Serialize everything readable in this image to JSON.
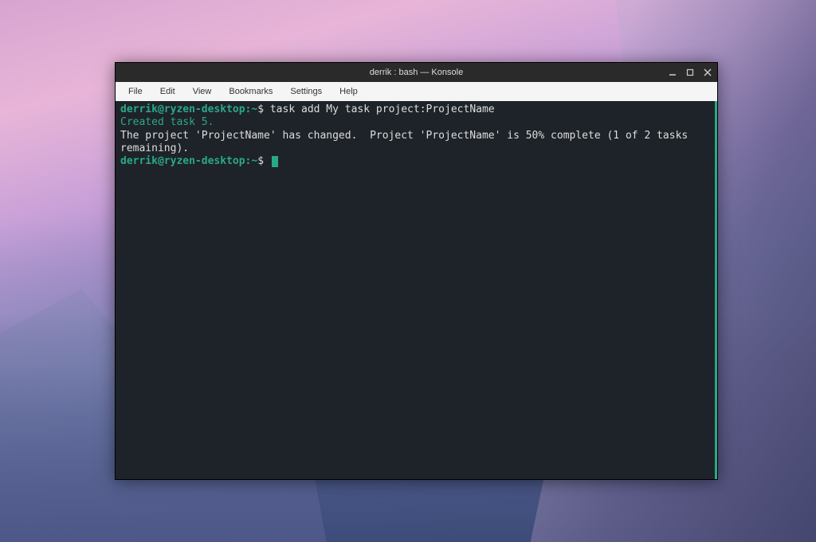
{
  "window": {
    "title": "derrik : bash — Konsole"
  },
  "menu": {
    "file": "File",
    "edit": "Edit",
    "view": "View",
    "bookmarks": "Bookmarks",
    "settings": "Settings",
    "help": "Help"
  },
  "terminal": {
    "prompt1_user": "derrik@ryzen-desktop",
    "prompt1_path": ":~",
    "prompt1_symbol": "$ ",
    "command1": "task add My task project:ProjectName",
    "output_created": "Created task 5.",
    "output_project": "The project 'ProjectName' has changed.  Project 'ProjectName' is 50% complete (1 of 2 tasks remaining).",
    "prompt2_user": "derrik@ryzen-desktop",
    "prompt2_path": ":~",
    "prompt2_symbol": "$ "
  },
  "colors": {
    "terminal_bg": "#1e2329",
    "accent_green": "#2aa889",
    "text": "#ddd"
  }
}
